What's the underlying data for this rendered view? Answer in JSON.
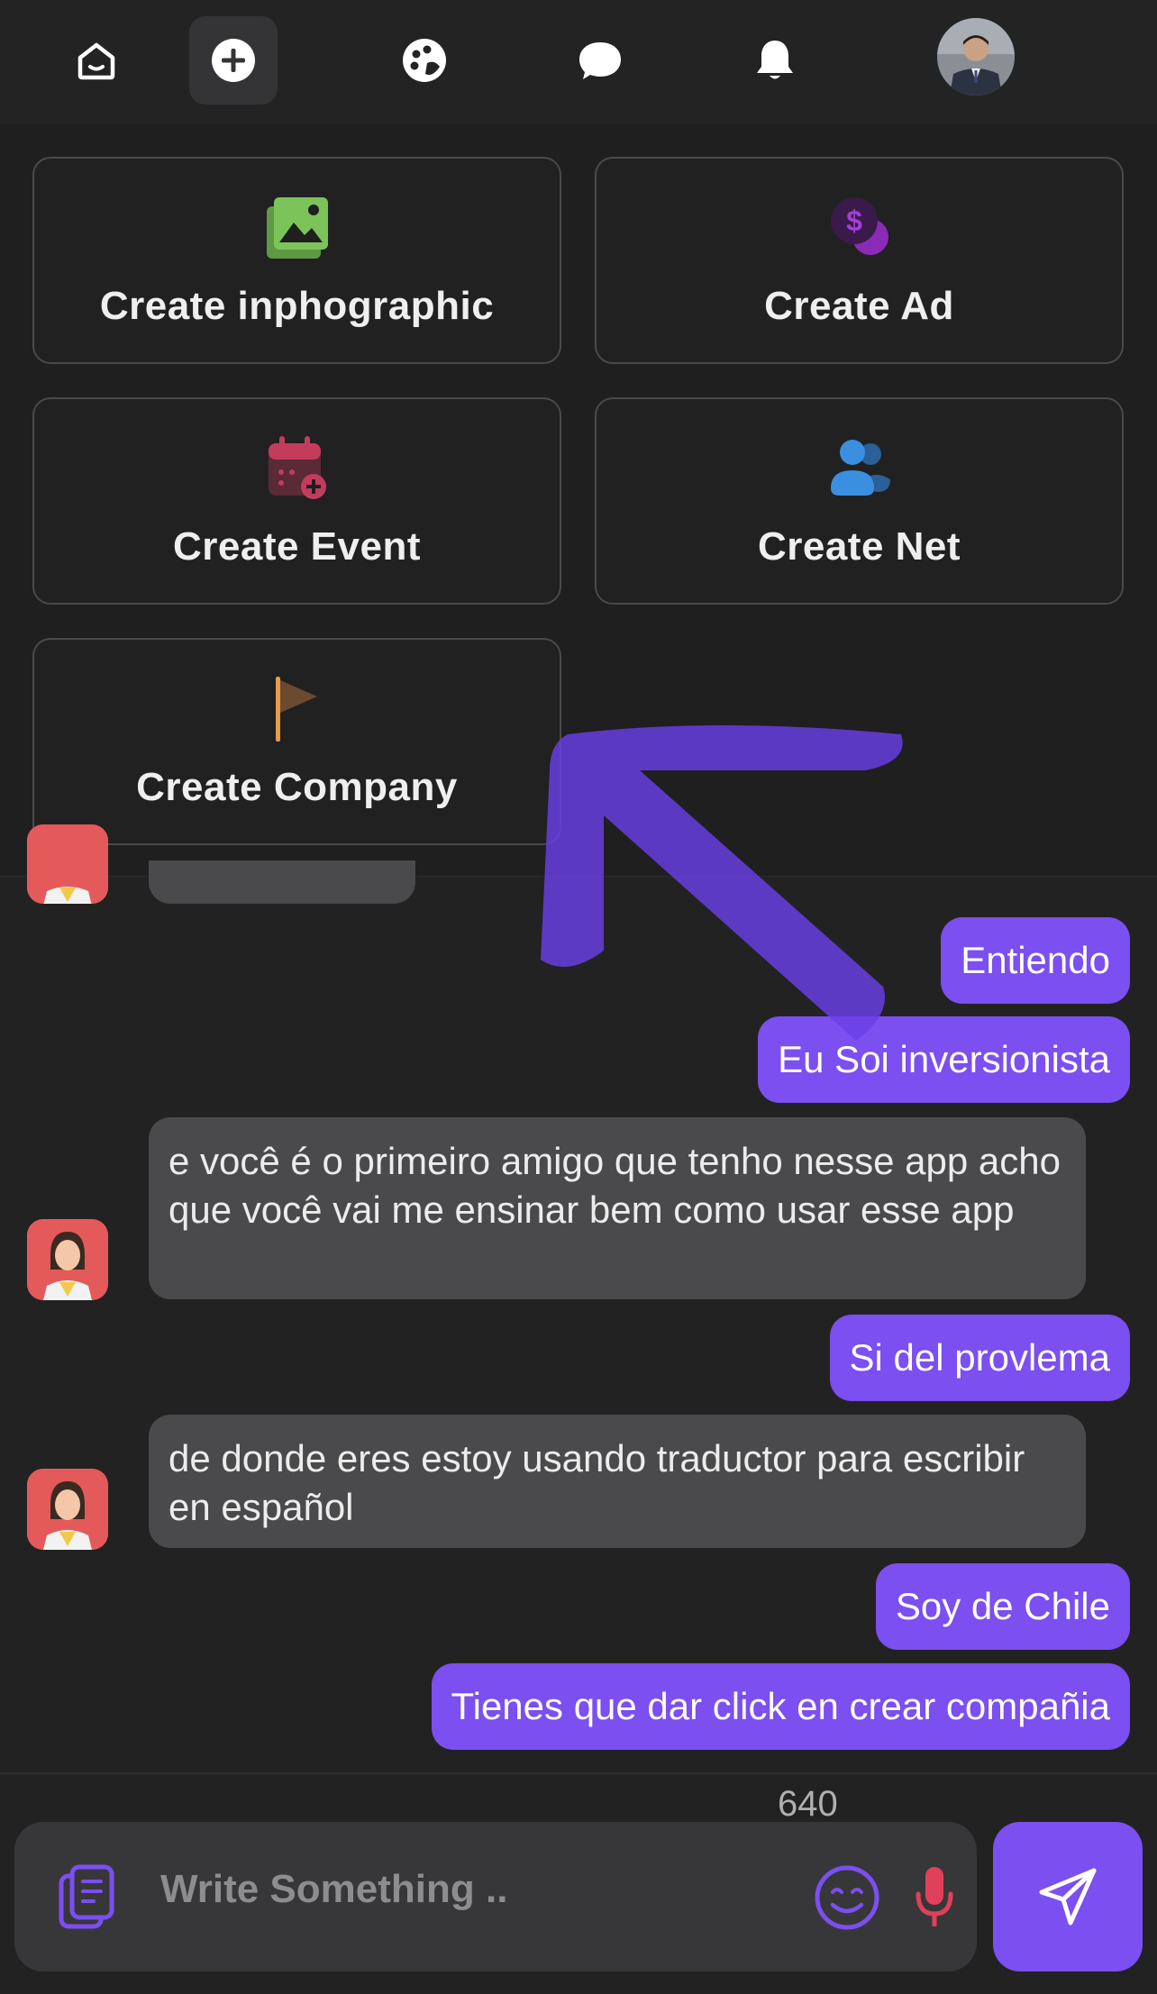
{
  "nav": {
    "items": [
      {
        "name": "home",
        "icon": "home-icon"
      },
      {
        "name": "create",
        "icon": "plus-circle-icon",
        "active": true
      },
      {
        "name": "explore",
        "icon": "palette-icon"
      },
      {
        "name": "messages",
        "icon": "chat-bubble-icon"
      },
      {
        "name": "notifications",
        "icon": "bell-icon"
      },
      {
        "name": "profile",
        "icon": "avatar"
      }
    ]
  },
  "create_menu": {
    "items": [
      {
        "label": "Create inphographic",
        "icon": "image-gallery-icon",
        "color": "#7cc35a"
      },
      {
        "label": "Create Ad",
        "icon": "dollar-coin-icon",
        "color": "#8a2bb8"
      },
      {
        "label": "Create Event",
        "icon": "calendar-add-icon",
        "color": "#c43c5c"
      },
      {
        "label": "Create Net",
        "icon": "users-icon",
        "color": "#3a8fe0"
      },
      {
        "label": "Create Company",
        "icon": "flag-icon",
        "color": "#e89a4a"
      }
    ]
  },
  "chat": {
    "messages": [
      {
        "from": "me",
        "text": "Entiendo"
      },
      {
        "from": "me",
        "text": "Eu Soi inversionista"
      },
      {
        "from": "other",
        "text": "e você é o primeiro amigo que tenho nesse app acho que você vai me ensinar bem como usar esse app"
      },
      {
        "from": "me",
        "text": "Si del provlema"
      },
      {
        "from": "other",
        "text": "de donde eres estoy usando traductor para escribir en español"
      },
      {
        "from": "me",
        "text": "Soy de Chile"
      },
      {
        "from": "me",
        "text": "Tienes que dar click en crear compañia"
      }
    ]
  },
  "composer": {
    "counter": "640",
    "placeholder": "Write Something .."
  },
  "colors": {
    "accent": "#7b4ff0",
    "background": "#222223",
    "bubble_other": "#4a4a4c",
    "mic": "#e0405a"
  }
}
